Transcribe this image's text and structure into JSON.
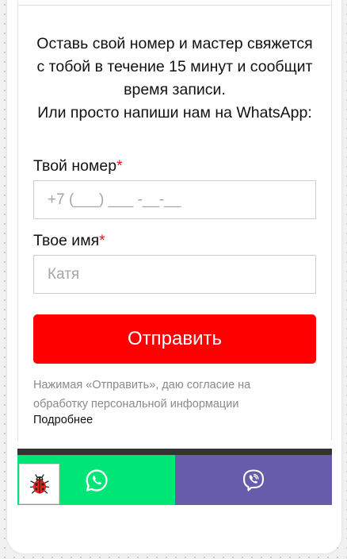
{
  "form": {
    "intro_lines": [
      "Оставь свой номер и мастер свяжется",
      "с тобой в течение 15 минут и сообщит",
      "время записи.",
      "Или просто напиши нам на WhatsApp:"
    ],
    "phone": {
      "label": "Твой номер",
      "required_mark": "*",
      "placeholder": "+7 (___) ___ -__-__"
    },
    "name": {
      "label": "Твое имя",
      "required_mark": "*",
      "placeholder": "Катя"
    },
    "submit_label": "Отправить",
    "consent_text": "Нажимая «Отправить», даю согласие на обработку персональной информации",
    "more_link": "Подробнее"
  },
  "messengers": {
    "whatsapp": {
      "icon": "whatsapp-icon",
      "color": "#00e676"
    },
    "viber": {
      "icon": "viber-icon",
      "color": "#665ca9"
    }
  },
  "widget": {
    "icon": "ladybug-icon"
  },
  "colors": {
    "accent": "#ff0000",
    "required": "#e31b1b"
  }
}
